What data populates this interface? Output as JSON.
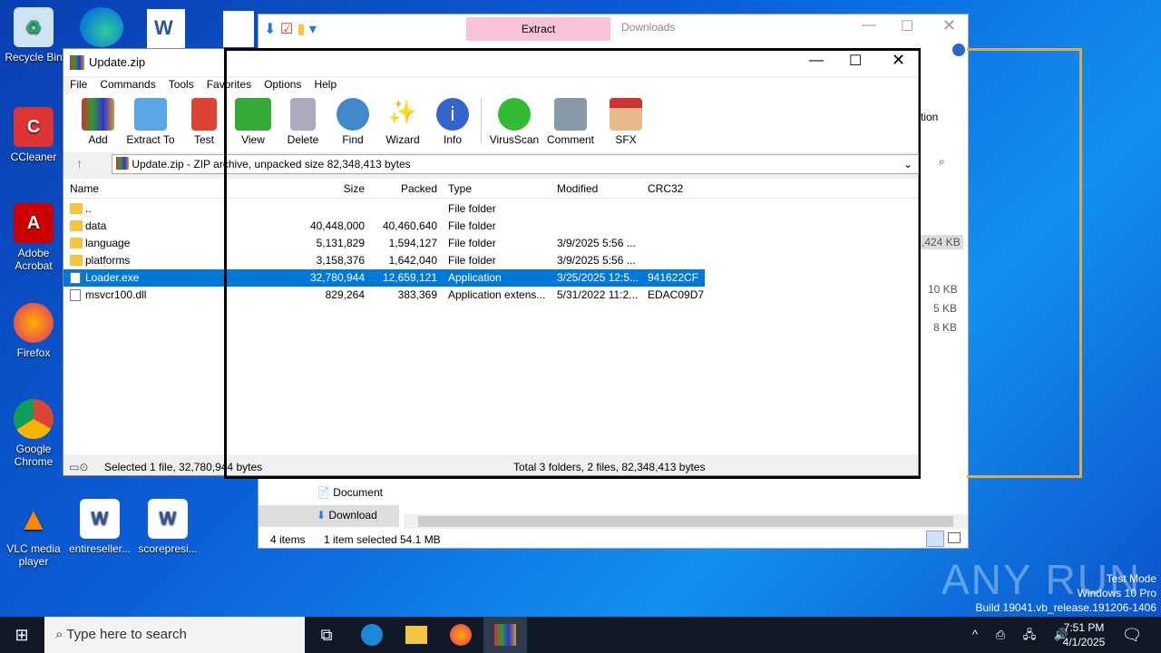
{
  "desktop": {
    "icons": [
      {
        "label": "Recycle Bin",
        "icon": "recycle-bin-icon"
      },
      {
        "label": "CCleaner",
        "icon": "ccleaner-icon"
      },
      {
        "label": "Adobe Acrobat",
        "icon": "acrobat-icon"
      },
      {
        "label": "Firefox",
        "icon": "firefox-icon"
      },
      {
        "label": "Google Chrome",
        "icon": "chrome-icon"
      },
      {
        "label": "VLC media player",
        "icon": "vlc-icon"
      },
      {
        "label": "entireseller...",
        "icon": "word-doc-icon"
      },
      {
        "label": "scorepresi...",
        "icon": "word-doc-icon"
      }
    ]
  },
  "explorer": {
    "ribbon_tab": "Extract",
    "title": "Downloads",
    "side_partial": "tion",
    "size_partial": ",424 KB",
    "sizes": [
      "10 KB",
      "5 KB",
      "8 KB"
    ],
    "nav": [
      "Document",
      "Download"
    ],
    "status_items": "4 items",
    "status_selected": "1 item selected",
    "status_size": "54.1 MB"
  },
  "winrar": {
    "title": "Update.zip",
    "menu": [
      "File",
      "Commands",
      "Tools",
      "Favorites",
      "Options",
      "Help"
    ],
    "toolbar": [
      "Add",
      "Extract To",
      "Test",
      "View",
      "Delete",
      "Find",
      "Wizard",
      "Info",
      "VirusScan",
      "Comment",
      "SFX"
    ],
    "address": "Update.zip - ZIP archive, unpacked size 82,348,413 bytes",
    "columns": [
      "Name",
      "Size",
      "Packed",
      "Type",
      "Modified",
      "CRC32"
    ],
    "rows": [
      {
        "name": "..",
        "size": "",
        "packed": "",
        "type": "File folder",
        "modified": "",
        "crc": ""
      },
      {
        "name": "data",
        "size": "40,448,000",
        "packed": "40,460,640",
        "type": "File folder",
        "modified": "",
        "crc": ""
      },
      {
        "name": "language",
        "size": "5,131,829",
        "packed": "1,594,127",
        "type": "File folder",
        "modified": "3/9/2025 5:56 ...",
        "crc": ""
      },
      {
        "name": "platforms",
        "size": "3,158,376",
        "packed": "1,642,040",
        "type": "File folder",
        "modified": "3/9/2025 5:56 ...",
        "crc": ""
      },
      {
        "name": "Loader.exe",
        "size": "32,780,944",
        "packed": "12,659,121",
        "type": "Application",
        "modified": "3/25/2025 12:5...",
        "crc": "941622CF"
      },
      {
        "name": "msvcr100.dll",
        "size": "829,264",
        "packed": "383,369",
        "type": "Application extens...",
        "modified": "5/31/2022 11:2...",
        "crc": "EDAC09D7"
      }
    ],
    "status_left": "Selected 1 file, 32,780,944 bytes",
    "status_right": "Total 3 folders, 2 files, 82,348,413 bytes"
  },
  "taskbar": {
    "search_placeholder": "Type here to search",
    "time": "7:51 PM",
    "date": "4/1/2025"
  },
  "watermark": {
    "logo": "ANY RUN",
    "line1": "Test Mode",
    "line2": "Windows 10 Pro",
    "line3": "Build 19041.vb_release.191206-1406"
  },
  "colors": {
    "selection": "#0078d7",
    "highlight": "#e8a840"
  }
}
